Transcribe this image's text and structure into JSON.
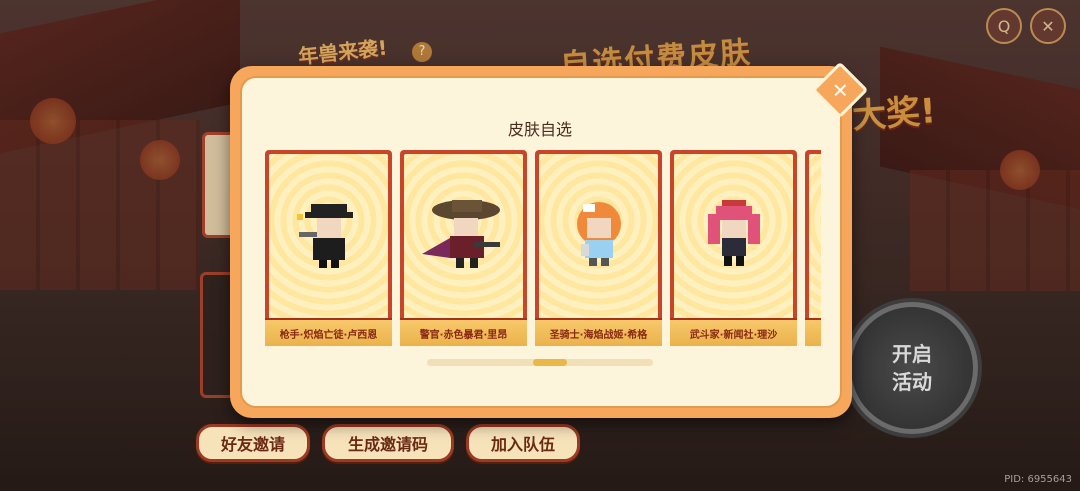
{
  "background": {
    "event_title": "年兽来袭!",
    "help_icon": "question-mark-icon",
    "banner_line1": "自选付费皮肤",
    "banner_line2": "大奖!"
  },
  "top_icons": [
    {
      "name": "search-icon",
      "glyph": "Q"
    },
    {
      "name": "close-icon",
      "glyph": "✕"
    }
  ],
  "modal": {
    "title": "皮肤自选",
    "close_glyph": "✕",
    "skins": [
      {
        "name": "枪手·炽焰亡徒·卢西恩",
        "sprite": "gunner-sprite"
      },
      {
        "name": "警官·赤色暴君·里昂",
        "sprite": "officer-sprite"
      },
      {
        "name": "圣骑士·海焰战姬·希格",
        "sprite": "paladin-sprite"
      },
      {
        "name": "武斗家·新闻社·理沙",
        "sprite": "fighter-sprite"
      }
    ],
    "scroll_progress": 0.55
  },
  "open_button": {
    "line1": "开启",
    "line2": "活动"
  },
  "bottom_buttons": [
    {
      "label": "好友邀请"
    },
    {
      "label": "生成邀请码"
    },
    {
      "label": "加入队伍"
    }
  ],
  "pid": "PID: 6955643",
  "colors": {
    "accent": "#f7a75b",
    "card_red": "#c8452a",
    "modal_bg": "#fdf4dc"
  }
}
